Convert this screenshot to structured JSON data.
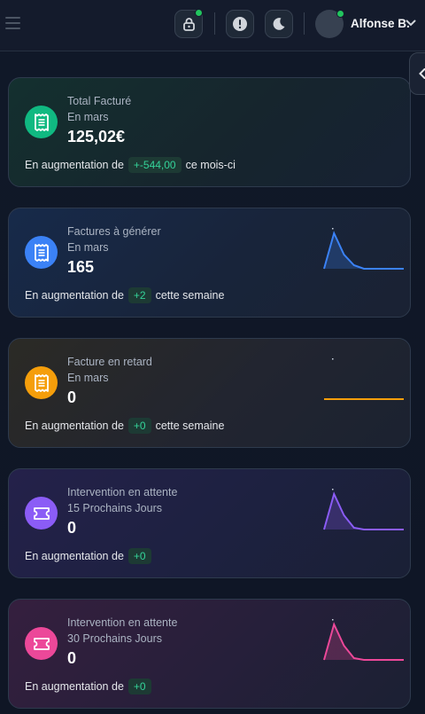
{
  "header": {
    "user_name": "Alfonse B.",
    "icons": [
      "menu-icon",
      "lock-icon",
      "alert-icon",
      "moon-icon",
      "chevron-down-icon",
      "chevron-left-icon"
    ],
    "status_color": "#22c55e"
  },
  "cards": [
    {
      "title": "Total Facturé",
      "subtitle": "En mars",
      "value": "125,02€",
      "trend_prefix": "En augmentation de",
      "trend_value": "+-544,00",
      "trend_suffix": "ce mois-ci",
      "icon": "receipt-icon",
      "accent": "#10b981",
      "chart": null
    },
    {
      "title": "Factures à générer",
      "subtitle": "En mars",
      "value": "165",
      "trend_prefix": "En augmentation de",
      "trend_value": "+2",
      "trend_suffix": "cette semaine",
      "icon": "receipt-icon",
      "accent": "#3b82f6",
      "chart": {
        "type": "area",
        "values": [
          0,
          100,
          40,
          10,
          0,
          0,
          0,
          0,
          0
        ]
      }
    },
    {
      "title": "Facture en retard",
      "subtitle": "En mars",
      "value": "0",
      "trend_prefix": "En augmentation de",
      "trend_value": "+0",
      "trend_suffix": "cette semaine",
      "icon": "receipt-icon",
      "accent": "#f59e0b",
      "chart": {
        "type": "area",
        "values": [
          0,
          0,
          0,
          0,
          0,
          0,
          0,
          0,
          0
        ]
      }
    },
    {
      "title": "Intervention en attente",
      "subtitle": "15 Prochains Jours",
      "value": "0",
      "trend_prefix": "En augmentation de",
      "trend_value": "+0",
      "trend_suffix": "",
      "icon": "ticket-icon",
      "accent": "#8b5cf6",
      "chart": {
        "type": "area",
        "values": [
          0,
          100,
          40,
          5,
          0,
          0,
          0,
          0,
          0
        ]
      }
    },
    {
      "title": "Intervention en attente",
      "subtitle": "30 Prochains Jours",
      "value": "0",
      "trend_prefix": "En augmentation de",
      "trend_value": "+0",
      "trend_suffix": "",
      "icon": "ticket-icon",
      "accent": "#ec4899",
      "chart": {
        "type": "area",
        "values": [
          0,
          100,
          40,
          5,
          0,
          0,
          0,
          0,
          0
        ]
      }
    }
  ]
}
